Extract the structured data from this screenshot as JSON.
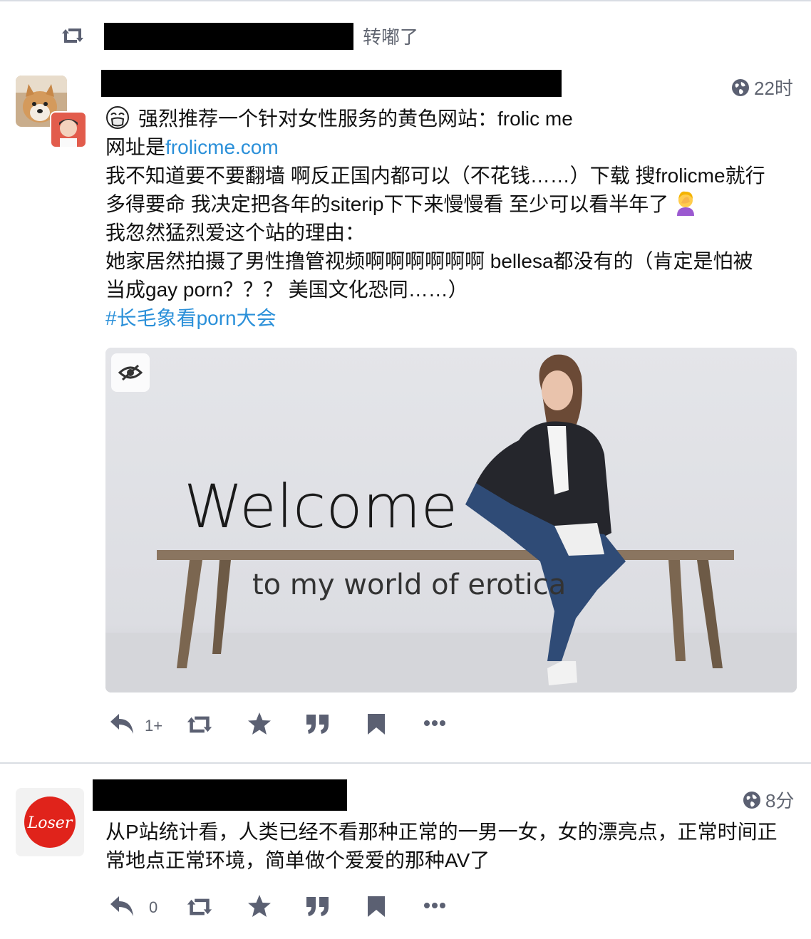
{
  "boost": {
    "label": "转嘟了"
  },
  "post1": {
    "time": "22时",
    "lines": [
      "强烈推荐一个针对女性服务的黄色网站：frolic me",
      "网址是",
      "我不知道要不要翻墙 啊反正国内都可以（不花钱……）下载 搜frolicme就行",
      "多得要命 我决定把各年的siterip下下来慢慢看 至少可以看半年了",
      "我忽然猛烈爱这个站的理由：",
      "她家居然拍摄了男性撸管视频啊啊啊啊啊啊 bellesa都没有的（肯定是怕被",
      "当成gay porn？？？ 美国文化恐同……）"
    ],
    "link": "frolicme.com",
    "hashtag": "#长毛象看porn大会",
    "image": {
      "title": "Welcome",
      "subtitle": "to my world of erotica"
    },
    "reply_count": "1+"
  },
  "post2": {
    "time": "8分",
    "avatar_text": "Loser",
    "lines": [
      "从P站统计看，人类已经不看那种正常的一男一女，女的漂亮点，正常时间正",
      "常地点正常环境，简单做个爱爱的那种AV了"
    ],
    "reply_count": "0"
  },
  "colors": {
    "accent": "#2b90d9",
    "muted": "#5f6470",
    "icon": "#5b6072"
  }
}
